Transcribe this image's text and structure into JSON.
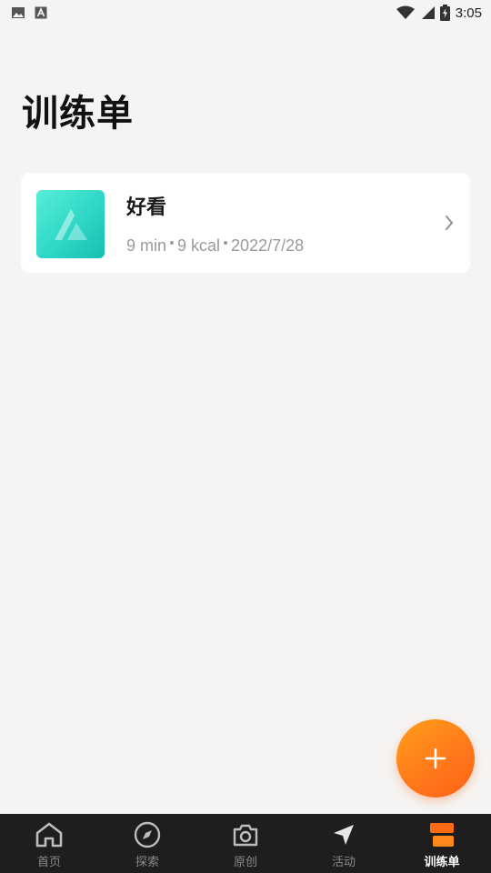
{
  "status_bar": {
    "time": "3:05",
    "left_icons": [
      "image-icon",
      "a-icon"
    ],
    "right_icons": [
      "wifi-icon",
      "signal-icon",
      "battery-icon"
    ]
  },
  "page": {
    "title": "训练单"
  },
  "plans": [
    {
      "name": "好看",
      "duration": "9 min",
      "calories": "9 kcal",
      "date": "2022/7/28"
    }
  ],
  "fab": {
    "icon": "plus-icon"
  },
  "bottom_nav": {
    "items": [
      {
        "label": "首页",
        "icon": "home-icon",
        "active": false
      },
      {
        "label": "探索",
        "icon": "compass-icon",
        "active": false
      },
      {
        "label": "原创",
        "icon": "camera-icon",
        "active": false
      },
      {
        "label": "活动",
        "icon": "navigation-arrow-icon",
        "active": false
      },
      {
        "label": "训练单",
        "icon": "training-list-icon",
        "active": true
      }
    ]
  },
  "colors": {
    "background": "#f5f4f3",
    "accent": "#ff7a1a",
    "thumbnail": "#2fd7c6",
    "nav_background": "#1e1e1e"
  }
}
